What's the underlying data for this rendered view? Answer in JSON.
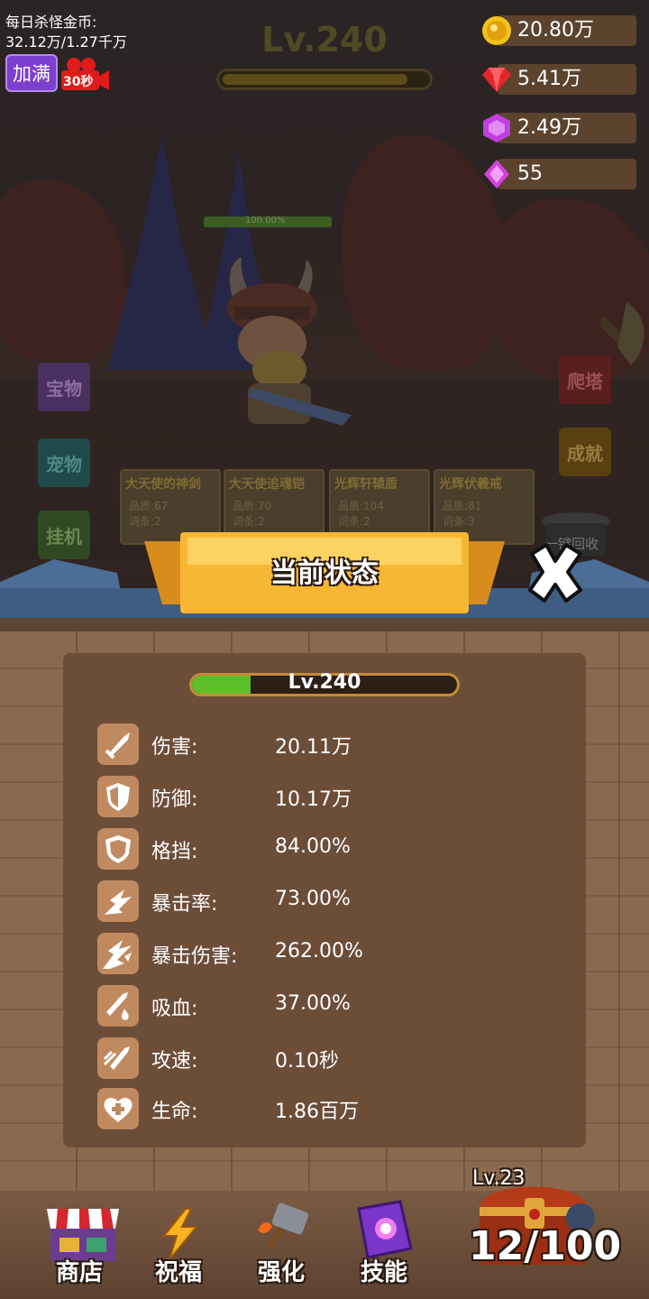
{
  "hud": {
    "daily_coins_label": "每日杀怪金币:",
    "daily_coins_value": "32.12万/1.27千万",
    "fill_button": "加满",
    "video_timer": "30秒",
    "stage_level": "Lv.240",
    "resources": [
      {
        "icon": "gold-coin-icon",
        "value": "20.80万"
      },
      {
        "icon": "ruby-icon",
        "value": "5.41万"
      },
      {
        "icon": "purple-gem-icon",
        "value": "2.49万"
      },
      {
        "icon": "diamond-icon",
        "value": "55"
      }
    ]
  },
  "scene": {
    "hero_hp": "100.00%",
    "left_buttons": [
      "宝物",
      "宠物",
      "挂机"
    ],
    "right_buttons": [
      "爬塔",
      "成就"
    ],
    "recycle_label": "一键回收",
    "cards": [
      {
        "name": "大天使的神剑",
        "stat1": "品质:67",
        "stat2": "词条:2"
      },
      {
        "name": "大天使追魂铠",
        "stat1": "品质:70",
        "stat2": "词条:2"
      },
      {
        "name": "光辉轩辕盾",
        "stat1": "品质:104",
        "stat2": "词条:2"
      },
      {
        "name": "光辉伏羲戒",
        "stat1": "品质:81",
        "stat2": "词条:3"
      }
    ]
  },
  "dialog": {
    "title": "当前状态",
    "level": "Lv.240",
    "level_progress": 0.22,
    "stats": [
      {
        "icon": "sword-icon",
        "label": "伤害:",
        "value": "20.11万"
      },
      {
        "icon": "shield-icon",
        "label": "防御:",
        "value": "10.17万"
      },
      {
        "icon": "block-shield-icon",
        "label": "格挡:",
        "value": "84.00%"
      },
      {
        "icon": "crit-burst-icon",
        "label": "暴击率:",
        "value": "73.00%"
      },
      {
        "icon": "crit-damage-icon",
        "label": "暴击伤害:",
        "value": "262.00%"
      },
      {
        "icon": "lifesteal-icon",
        "label": "吸血:",
        "value": "37.00%"
      },
      {
        "icon": "attack-speed-icon",
        "label": "攻速:",
        "value": "0.10秒"
      },
      {
        "icon": "heart-plus-icon",
        "label": "生命:",
        "value": "1.86百万"
      }
    ]
  },
  "bottom_nav": [
    {
      "icon": "shop-icon",
      "label": "商店"
    },
    {
      "icon": "lightning-icon",
      "label": "祝福"
    },
    {
      "icon": "hammer-icon",
      "label": "强化"
    },
    {
      "icon": "spellbook-icon",
      "label": "技能"
    }
  ],
  "chest": {
    "level": "Lv.23",
    "count": "12/100"
  },
  "colors": {
    "accent_yellow": "#f8b733",
    "panel_brown": "#6c4d38",
    "icon_tan": "#c08a61",
    "hp_green": "#5fbf2a"
  }
}
